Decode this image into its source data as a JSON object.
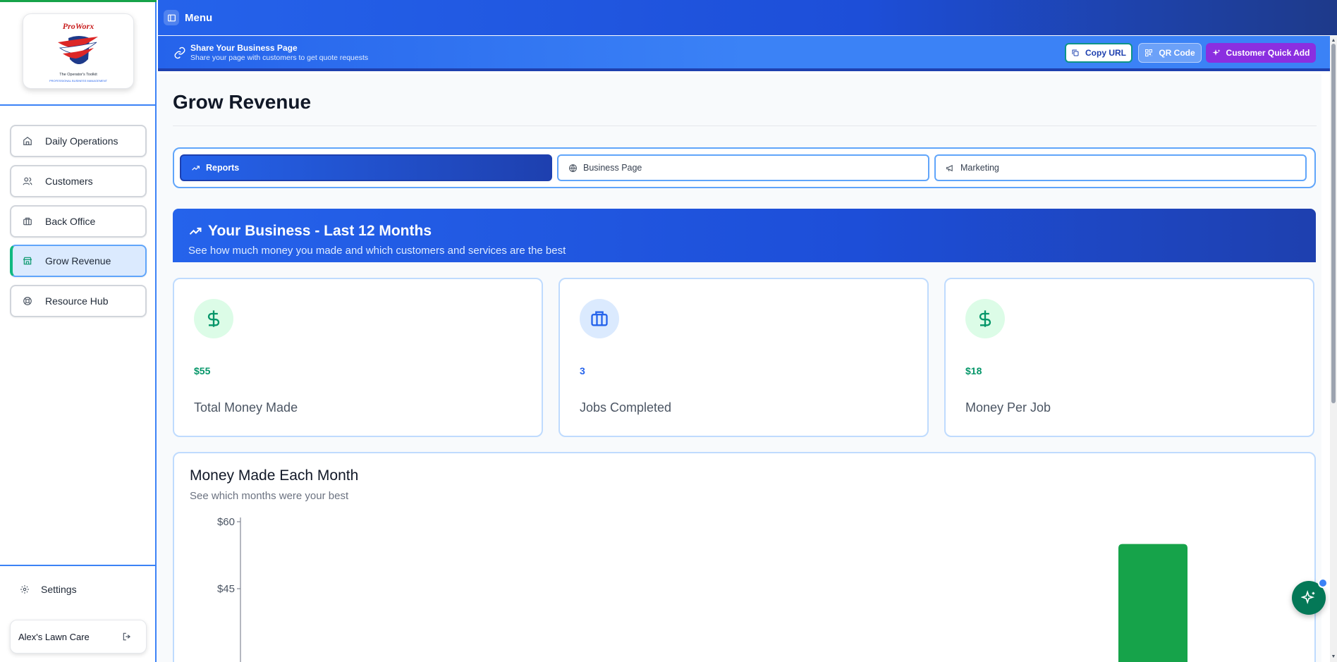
{
  "brand": {
    "name": "ProWorx",
    "tagline": "The Operator's Toolkit",
    "subtitle": "PROFESSIONAL BUSINESS MANAGEMENT"
  },
  "sidebar": {
    "items": [
      {
        "label": "Daily Operations",
        "icon": "home-icon"
      },
      {
        "label": "Customers",
        "icon": "users-icon"
      },
      {
        "label": "Back Office",
        "icon": "briefcase-icon"
      },
      {
        "label": "Grow Revenue",
        "icon": "store-icon",
        "active": true
      },
      {
        "label": "Resource Hub",
        "icon": "lifebuoy-icon"
      }
    ],
    "settings_label": "Settings",
    "account_name": "Alex's Lawn Care"
  },
  "topbar": {
    "menu_label": "Menu"
  },
  "share": {
    "title": "Share Your Business Page",
    "subtitle": "Share your page with customers to get quote requests",
    "copy_label": "Copy URL",
    "qr_label": "QR Code",
    "quick_add_label": "Customer Quick Add"
  },
  "page": {
    "title": "Grow Revenue"
  },
  "tabs": [
    {
      "label": "Reports",
      "active": true
    },
    {
      "label": "Business Page",
      "active": false
    },
    {
      "label": "Marketing",
      "active": false
    }
  ],
  "hero": {
    "title": "Your Business - Last 12 Months",
    "subtitle": "See how much money you made and which customers and services are the best"
  },
  "stats": [
    {
      "value": "$55",
      "label": "Total Money Made",
      "color": "green",
      "icon": "dollar-icon"
    },
    {
      "value": "3",
      "label": "Jobs Completed",
      "color": "blue",
      "icon": "briefcase-icon"
    },
    {
      "value": "$18",
      "label": "Money Per Job",
      "color": "green",
      "icon": "dollar-icon"
    }
  ],
  "chart": {
    "title": "Money Made Each Month",
    "subtitle": "See which months were your best"
  },
  "chart_data": {
    "type": "bar",
    "title": "Money Made Each Month",
    "subtitle": "See which months were your best",
    "ytick_labels": [
      "$60",
      "$45"
    ],
    "yticks": [
      60,
      45
    ],
    "ylim": [
      0,
      60
    ],
    "bar_color": "#16a34a",
    "values": [
      55
    ],
    "bar_position_fraction": 0.86
  },
  "colors": {
    "primary": "#2563eb",
    "accent_green": "#16a34a",
    "accent_purple": "#8b2fe0"
  }
}
